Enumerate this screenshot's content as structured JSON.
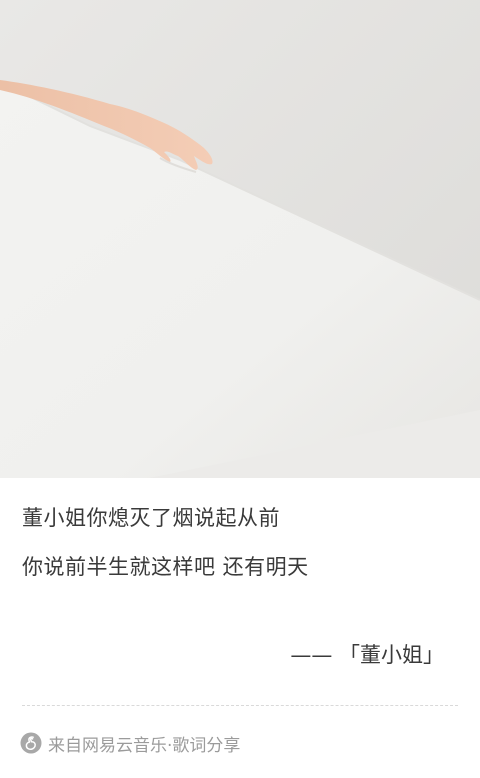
{
  "lyrics": {
    "line1": "董小姐你熄灭了烟说起从前",
    "line2": "你说前半生就这样吧 还有明天"
  },
  "attribution": "—— 「董小姐」",
  "footer": {
    "logo_icon": "netease-cloud-music-logo",
    "text": "来自网易云音乐·歌词分享"
  },
  "colors": {
    "text": "#3a3a3a",
    "muted": "#9b9b9b",
    "photo_background": "#e4e3e1"
  }
}
